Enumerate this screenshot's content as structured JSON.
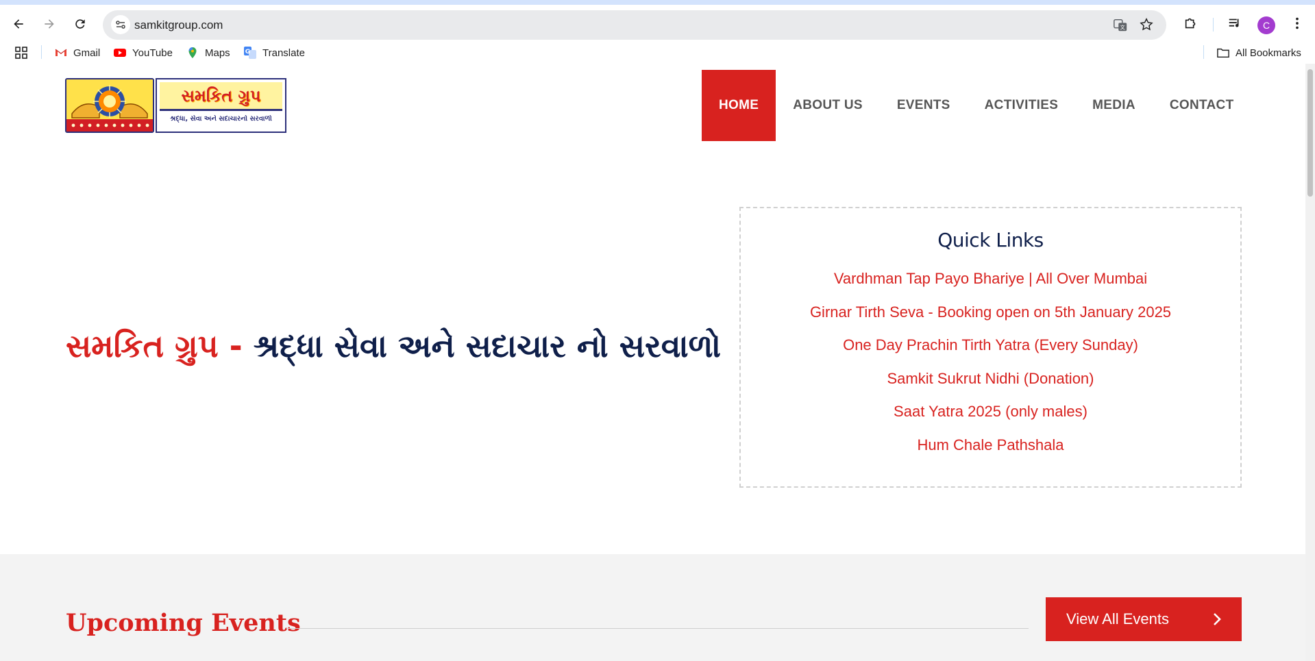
{
  "browser": {
    "url": "samkitgroup.com",
    "avatar_letter": "C",
    "bookmarks": [
      {
        "label": "Gmail",
        "icon": "gmail-icon"
      },
      {
        "label": "YouTube",
        "icon": "youtube-icon"
      },
      {
        "label": "Maps",
        "icon": "maps-icon"
      },
      {
        "label": "Translate",
        "icon": "translate-icon"
      }
    ],
    "all_bookmarks": "All Bookmarks"
  },
  "site": {
    "logo": {
      "title": "સમકિત ગ્રુપ",
      "subtitle": "શ્રદ્ધા, સેવા અને સદાચારનો સરવાળો"
    },
    "nav": [
      {
        "label": "HOME",
        "active": true
      },
      {
        "label": "ABOUT US",
        "active": false
      },
      {
        "label": "EVENTS",
        "active": false
      },
      {
        "label": "ACTIVITIES",
        "active": false
      },
      {
        "label": "MEDIA",
        "active": false
      },
      {
        "label": "CONTACT",
        "active": false
      }
    ],
    "hero": {
      "brand": "સમકિત ગ્રુપ",
      "dash": "-",
      "tagline": "શ્રદ્ધા સેવા અને સદાચાર નો સરવાળો"
    },
    "quick_links": {
      "title": "Quick Links",
      "items": [
        "Vardhman Tap Payo Bhariye | All Over Mumbai",
        "Girnar Tirth Seva - Booking open on 5th January 2025",
        "One Day Prachin Tirth Yatra (Every Sunday)",
        "Samkit Sukrut Nidhi (Donation)",
        "Saat Yatra 2025 (only males)",
        "Hum Chale Pathshala"
      ]
    },
    "events": {
      "title": "Upcoming Events",
      "view_all": "View All Events"
    }
  },
  "colors": {
    "brand_red": "#d8221f",
    "navy": "#0f1f4a",
    "nav_text": "#555555"
  }
}
